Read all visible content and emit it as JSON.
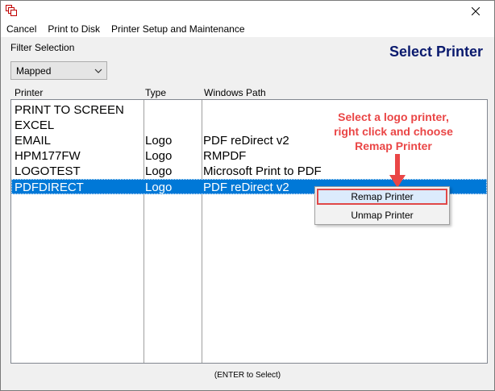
{
  "menubar": {
    "items": [
      "Cancel",
      "Print to Disk",
      "Printer Setup and Maintenance"
    ]
  },
  "filter": {
    "label": "Filter Selection",
    "selected": "Mapped"
  },
  "heading": "Select Printer",
  "columns": [
    "Printer",
    "Type",
    "Windows Path"
  ],
  "rows": [
    {
      "printer": "PRINT TO SCREEN",
      "type": "",
      "path": ""
    },
    {
      "printer": "EXCEL",
      "type": "",
      "path": ""
    },
    {
      "printer": "EMAIL",
      "type": "Logo",
      "path": "PDF reDirect v2"
    },
    {
      "printer": "HPM177FW",
      "type": "Logo",
      "path": "RMPDF"
    },
    {
      "printer": "LOGOTEST",
      "type": "Logo",
      "path": "Microsoft Print to PDF"
    },
    {
      "printer": "PDFDIRECT",
      "type": "Logo",
      "path": "PDF reDirect v2"
    }
  ],
  "selected_row": 5,
  "context_menu": {
    "items": [
      "Remap Printer",
      "Unmap Printer"
    ]
  },
  "callout": {
    "line1": "Select a logo printer,",
    "line2": "right click and choose",
    "line3": "Remap Printer"
  },
  "footer": "(ENTER to Select)",
  "colors": {
    "selection": "#0078d7",
    "title": "#0a1a6e",
    "annotation": "#ea4646"
  }
}
